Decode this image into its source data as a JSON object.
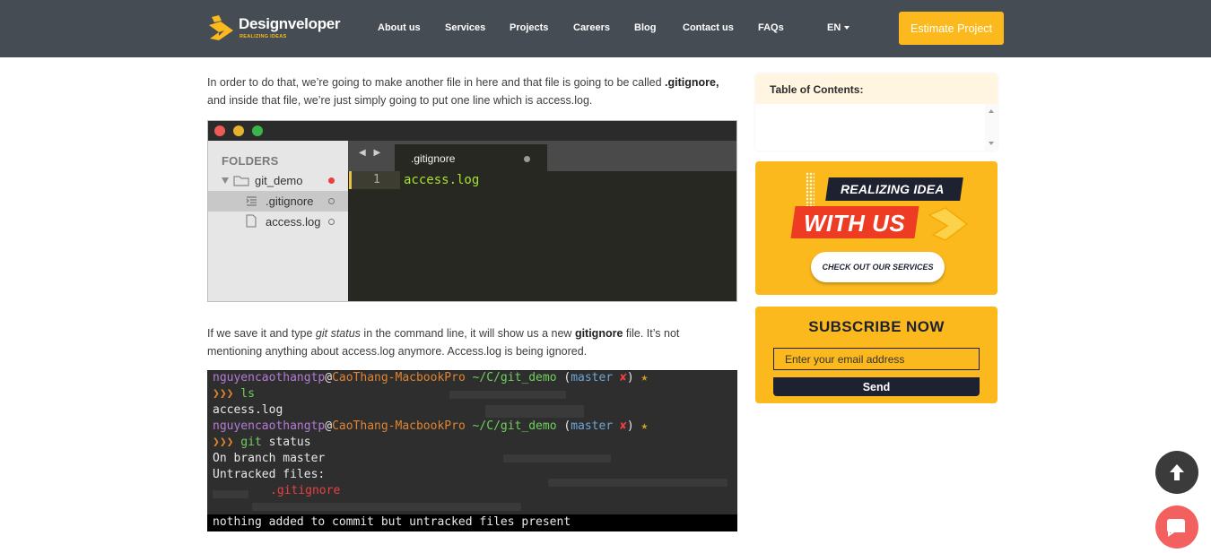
{
  "header": {
    "logo_text": "Designveloper",
    "logo_tagline": "REALIZING IDEAS",
    "nav": [
      "About us",
      "Services",
      "Projects",
      "Careers",
      "Blog",
      "Contact us",
      "FAQs"
    ],
    "language": "EN",
    "cta_label": "Estimate Project",
    "brand_color": "#fbb91d",
    "header_color": "#464c53"
  },
  "article": {
    "para1": {
      "before": "In order to do that, we’re going to make another file in here and that file is going to be called ",
      "bold": ".gitignore,",
      "after": " and inside that file, we’re just simply going to put one line which is access.log."
    },
    "para2": {
      "part1": "If we save it and type ",
      "italic": "git status",
      "part2": " in the command line, it will show us a new ",
      "bold": "gitignore",
      "part3": " file. It’s not mentioning anything about access.log anymore. Access.log is being ignored."
    }
  },
  "editor": {
    "sidebar_header": "FOLDERS",
    "folder": "git_demo",
    "files": [
      ".gitignore",
      "access.log"
    ],
    "tab_label": ".gitignore",
    "line_number": "1",
    "code_line": "access.log"
  },
  "terminal": {
    "user": "nguyencaothangtp",
    "at": "@",
    "host": "CaoThang-MacbookPro",
    "path": " ~/C/git_demo",
    "branch_open": " (",
    "branch": "master",
    "branch_mark": " ✘",
    "branch_close": ")",
    "star": " ★",
    "prompt": "❯❯❯",
    "cmd1": " ls",
    "out1": "access.log",
    "cmd2": " git",
    "cmd2_rest": " status",
    "out2": "On branch master",
    "out3": "Untracked files:",
    "untracked": ".gitignore",
    "out4": "nothing added to commit but untracked files present"
  },
  "sidebar": {
    "toc_title": "Table of Contents:",
    "promo_line1": "REALIZING IDEA",
    "promo_line2": "WITH US",
    "promo_button": "CHECK OUT OUR SERVICES",
    "subscribe_title": "SUBSCRIBE NOW",
    "subscribe_placeholder": "Enter your email address",
    "subscribe_button": "Send"
  },
  "floating": {
    "to_top_icon": "arrow-up-icon",
    "chat_icon": "chat-bubble-icon"
  }
}
